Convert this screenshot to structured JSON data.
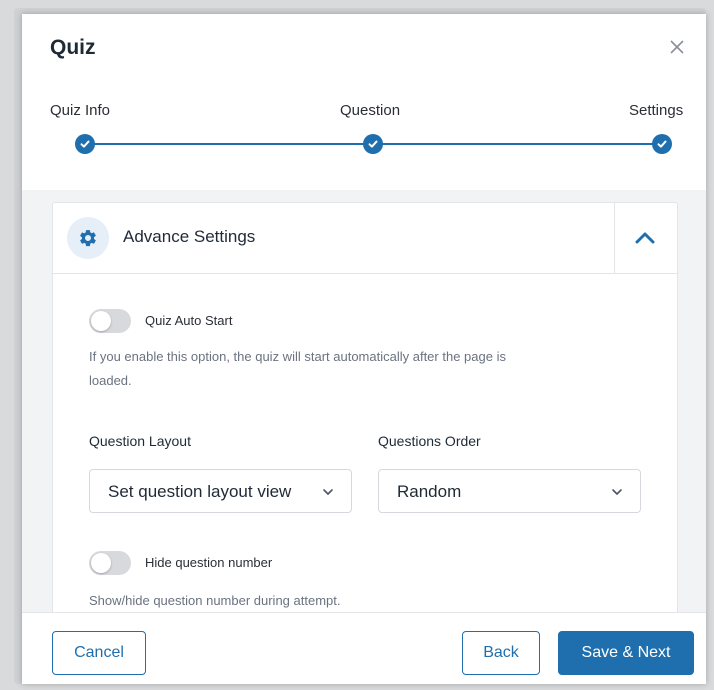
{
  "modal": {
    "title": "Quiz",
    "close_icon": "close-icon"
  },
  "stepper": {
    "steps": [
      {
        "label": "Quiz Info",
        "status": "completed"
      },
      {
        "label": "Question",
        "status": "completed"
      },
      {
        "label": "Settings",
        "status": "completed"
      }
    ],
    "step_icon": "check-icon"
  },
  "advance_settings": {
    "title": "Advance Settings",
    "icon": "gear-icon",
    "toggle_icon": "chevron-up-icon",
    "expanded": true,
    "quiz_auto_start": {
      "label": "Quiz Auto Start",
      "enabled": false,
      "help_line1": "If you enable this option, the quiz will start automatically after the page is",
      "help_line2": "loaded."
    },
    "question_layout": {
      "label": "Question Layout",
      "value": "Set question layout view"
    },
    "questions_order": {
      "label": "Questions Order",
      "value": "Random"
    },
    "hide_question_number": {
      "label": "Hide question number",
      "enabled": false,
      "help": "Show/hide question number during attempt."
    }
  },
  "footer": {
    "cancel_label": "Cancel",
    "back_label": "Back",
    "save_next_label": "Save & Next"
  },
  "colors": {
    "accent": "#1f6fae",
    "toggle_off": "#d7d9dd",
    "body_bg": "#f2f3f5"
  }
}
